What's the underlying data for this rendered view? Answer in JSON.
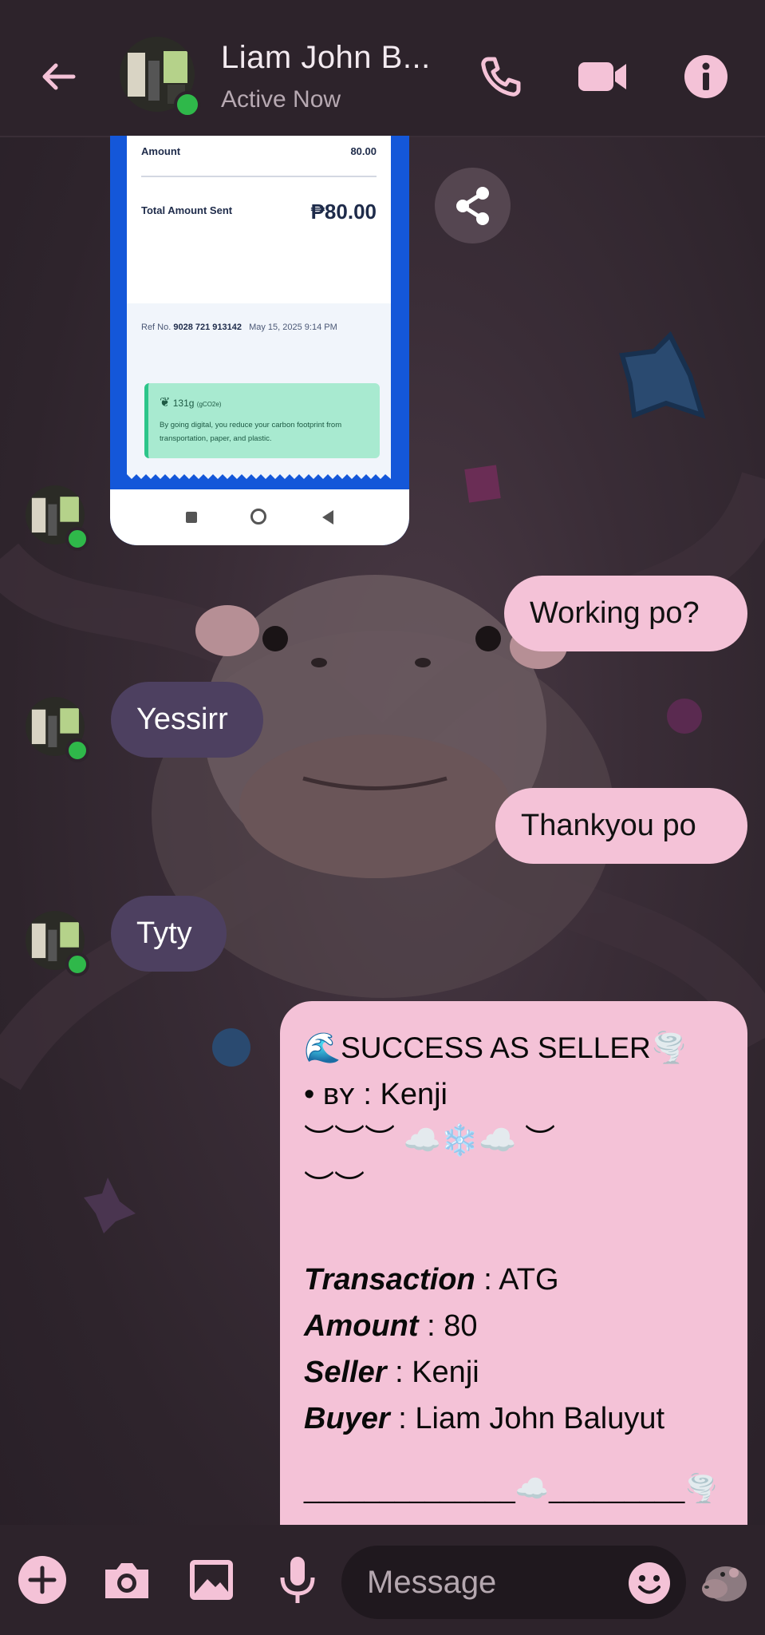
{
  "header": {
    "contact_name": "Liam John B...",
    "status": "Active Now"
  },
  "receipt": {
    "amount_label": "Amount",
    "amount_value": "80.00",
    "total_label": "Total Amount Sent",
    "total_value": "₱80.00",
    "ref_label": "Ref No.",
    "ref_number": "9028 721 913142",
    "ref_date": "May 15, 2025 9:14 PM",
    "eco_weight": "131g",
    "eco_unit": "(gCO2e)",
    "eco_text": "By going digital, you reduce your carbon footprint from transportation, paper, and plastic."
  },
  "messages": [
    {
      "side": "out",
      "text": "Working po?"
    },
    {
      "side": "in",
      "text": "Yessirr"
    },
    {
      "side": "out",
      "text": "Thankyou po"
    },
    {
      "side": "in",
      "text": "Tyty"
    }
  ],
  "success_card": {
    "title": "🌊SUCCESS AS SELLER🌪️",
    "by_prefix": "• ʙʏ",
    "by_value": ": Kenji",
    "deco_line1": "︶︶︶ ☁️❄️☁️ ︶",
    "deco_line2": "︶︶",
    "rows": [
      {
        "label": "Transaction",
        "value": " : ATG"
      },
      {
        "label": "Amount",
        "value": " : 80"
      },
      {
        "label": "Seller",
        "value": " : Kenji"
      },
      {
        "label": "Buyer",
        "value": " : Liam John Baluyut"
      }
    ],
    "divider": "______________☁️_________🌪️"
  },
  "composer": {
    "placeholder": "Message"
  },
  "colors": {
    "accent_pink": "#f4c2d7",
    "incoming_bubble": "#4d4060",
    "online_green": "#2fb84a"
  }
}
